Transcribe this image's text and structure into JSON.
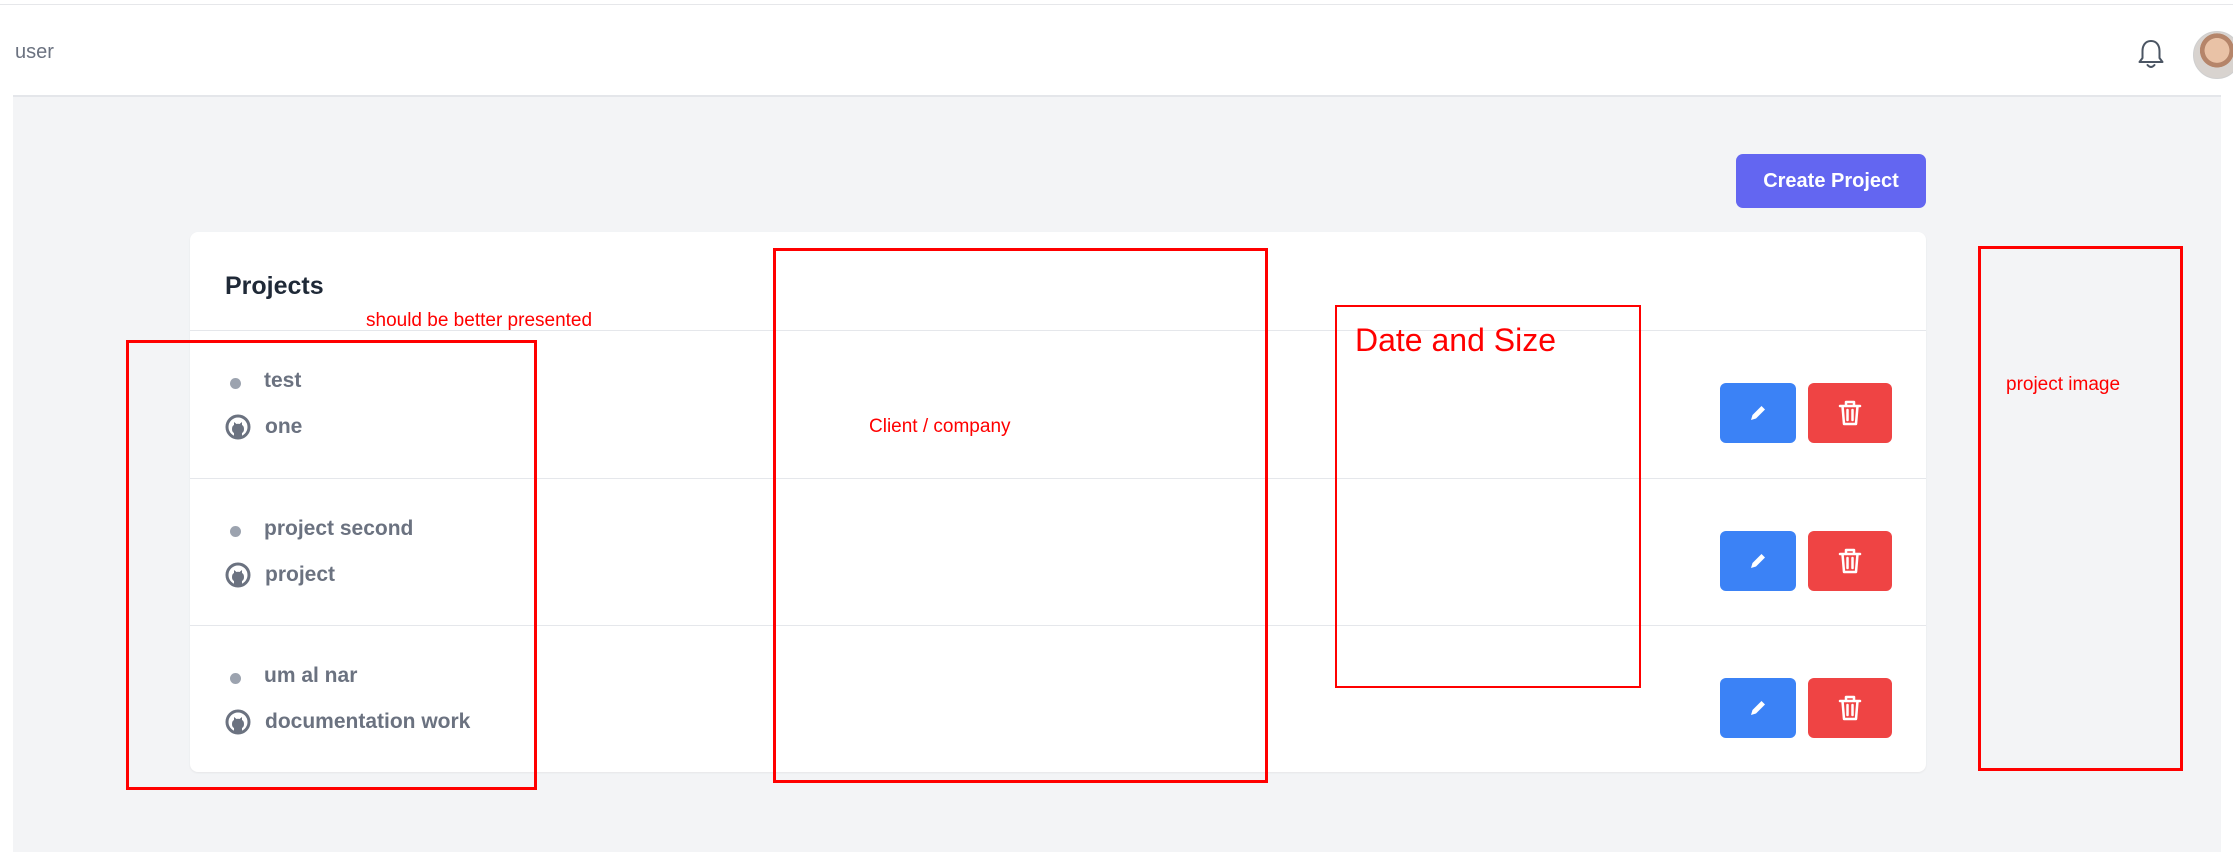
{
  "header": {
    "breadcrumb": "user",
    "notifications_icon": "bell-icon",
    "avatar_icon": "user-avatar"
  },
  "toolbar": {
    "create_label": "Create Project"
  },
  "projects": {
    "title": "Projects",
    "rows": [
      {
        "name": "test",
        "repo": "one"
      },
      {
        "name": "project second",
        "repo": "project"
      },
      {
        "name": "um al nar",
        "repo": "documentation work"
      }
    ],
    "edit_icon": "pencil-icon",
    "delete_icon": "trash-icon",
    "repo_icon": "github-icon"
  },
  "annotations": {
    "presentation_note": "should be better presented",
    "client_note": "Client / company",
    "date_note": "Date and Size",
    "image_note": "project image",
    "color": "#ff0000"
  },
  "colors": {
    "primary": "#6366f1",
    "edit": "#3b82f6",
    "delete": "#ef4444",
    "background": "#f3f4f6"
  }
}
